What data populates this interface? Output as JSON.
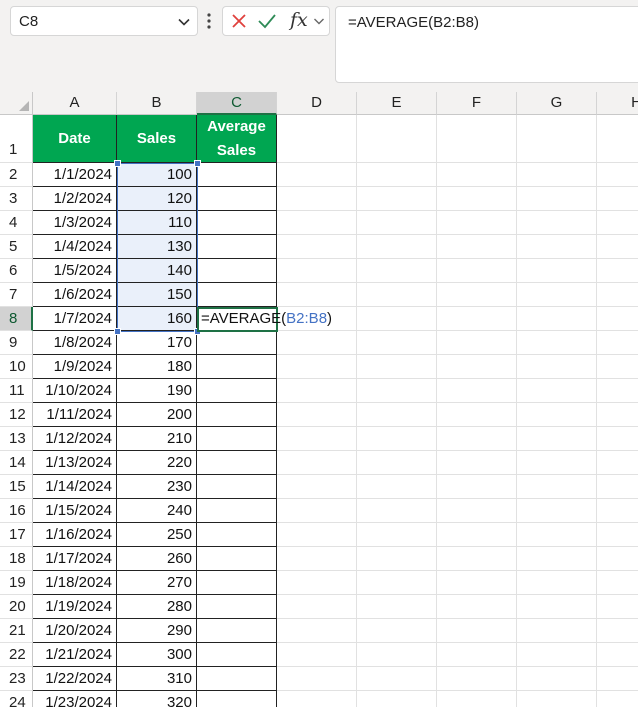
{
  "name_box": {
    "value": "C8"
  },
  "formula_bar": {
    "value": "=AVERAGE(B2:B8)",
    "fx_label": "fx"
  },
  "columns": [
    "A",
    "B",
    "C",
    "D",
    "E",
    "F",
    "G",
    "H"
  ],
  "headers": {
    "date": "Date",
    "sales": "Sales",
    "average_line1": "Average",
    "average_line2": "Sales"
  },
  "rows": [
    {
      "n": "1"
    },
    {
      "n": "2",
      "date": "1/1/2024",
      "sales": "100"
    },
    {
      "n": "3",
      "date": "1/2/2024",
      "sales": "120"
    },
    {
      "n": "4",
      "date": "1/3/2024",
      "sales": "110"
    },
    {
      "n": "5",
      "date": "1/4/2024",
      "sales": "130"
    },
    {
      "n": "6",
      "date": "1/5/2024",
      "sales": "140"
    },
    {
      "n": "7",
      "date": "1/6/2024",
      "sales": "150"
    },
    {
      "n": "8",
      "date": "1/7/2024",
      "sales": "160"
    },
    {
      "n": "9",
      "date": "1/8/2024",
      "sales": "170"
    },
    {
      "n": "10",
      "date": "1/9/2024",
      "sales": "180"
    },
    {
      "n": "11",
      "date": "1/10/2024",
      "sales": "190"
    },
    {
      "n": "12",
      "date": "1/11/2024",
      "sales": "200"
    },
    {
      "n": "13",
      "date": "1/12/2024",
      "sales": "210"
    },
    {
      "n": "14",
      "date": "1/13/2024",
      "sales": "220"
    },
    {
      "n": "15",
      "date": "1/14/2024",
      "sales": "230"
    },
    {
      "n": "16",
      "date": "1/15/2024",
      "sales": "240"
    },
    {
      "n": "17",
      "date": "1/16/2024",
      "sales": "250"
    },
    {
      "n": "18",
      "date": "1/17/2024",
      "sales": "260"
    },
    {
      "n": "19",
      "date": "1/18/2024",
      "sales": "270"
    },
    {
      "n": "20",
      "date": "1/19/2024",
      "sales": "280"
    },
    {
      "n": "21",
      "date": "1/20/2024",
      "sales": "290"
    },
    {
      "n": "22",
      "date": "1/21/2024",
      "sales": "300"
    },
    {
      "n": "23",
      "date": "1/22/2024",
      "sales": "310"
    },
    {
      "n": "24",
      "date": "1/23/2024",
      "sales": "320"
    }
  ],
  "editing": {
    "cell": "C8",
    "prefix": "=AVERAGE(",
    "ref": "B2:B8",
    "suffix": ")"
  },
  "selection": {
    "active_cell": "C8",
    "referenced_range": "B2:B8"
  },
  "icons": {
    "cancel": "close-icon",
    "enter": "checkmark-icon",
    "insert_function": "fx-icon",
    "dropdown": "chevron-down-icon",
    "more": "vertical-dots-icon"
  },
  "colors": {
    "header_fill": "#00a651",
    "header_text": "#ffffff",
    "active_border": "#1e7145",
    "range_border": "#4472c4",
    "range_fill": "#eaf0fa",
    "cancel_icon": "#e0413d",
    "enter_icon": "#2e8b57"
  }
}
